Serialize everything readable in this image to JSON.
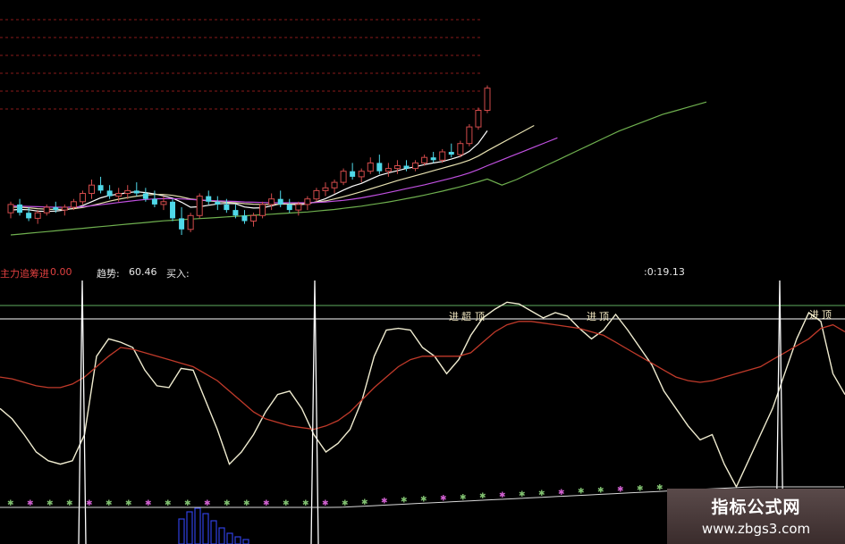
{
  "indicator_bar": {
    "name_label": "主力追筹进",
    "name_value": "0.00",
    "trend_label": "趋势:",
    "trend_value": "60.46",
    "buy_label": "买入:",
    "time_value": ":0:19.13"
  },
  "watermark": {
    "title": "指标公式网",
    "url": "www.zbgs3.com"
  },
  "colors": {
    "background": "#000000",
    "candle_up": "#d24b4b",
    "candle_down": "#4fd8e8",
    "ma_short": "#ffffff",
    "ma_mid": "#e6e0b0",
    "ma_long": "#c050e0",
    "ma_trend": "#6fb04f",
    "osc_fast": "#f0ecd0",
    "osc_slow": "#c03a2a",
    "signal_line": "#ffffff",
    "level_line_green": "#5fae5f",
    "level_line_white": "#ffffff",
    "dashed_grid": "#8a1a1a",
    "pink_marker": "#d060d0",
    "green_marker": "#80c070",
    "volume_bar": "#3040e0"
  },
  "chart_data": [
    {
      "type": "candlestick",
      "title": "",
      "ohlc": [
        [
          48,
          52,
          46,
          51
        ],
        [
          51,
          53,
          47,
          48
        ],
        [
          48,
          50,
          45,
          46
        ],
        [
          46,
          49,
          44,
          48
        ],
        [
          48,
          51,
          47,
          50
        ],
        [
          50,
          52,
          48,
          49
        ],
        [
          49,
          51,
          47,
          50
        ],
        [
          50,
          53,
          49,
          52
        ],
        [
          52,
          56,
          51,
          55
        ],
        [
          55,
          60,
          53,
          58
        ],
        [
          58,
          61,
          55,
          56
        ],
        [
          56,
          58,
          53,
          54
        ],
        [
          54,
          57,
          52,
          55
        ],
        [
          55,
          58,
          53,
          56
        ],
        [
          56,
          59,
          54,
          55
        ],
        [
          55,
          57,
          52,
          53
        ],
        [
          53,
          56,
          50,
          51
        ],
        [
          51,
          54,
          49,
          52
        ],
        [
          52,
          53,
          45,
          46
        ],
        [
          46,
          50,
          40,
          42
        ],
        [
          42,
          48,
          41,
          47
        ],
        [
          47,
          55,
          46,
          54
        ],
        [
          54,
          56,
          51,
          52
        ],
        [
          52,
          54,
          49,
          51
        ],
        [
          51,
          53,
          48,
          49
        ],
        [
          49,
          51,
          46,
          47
        ],
        [
          47,
          49,
          44,
          45
        ],
        [
          45,
          48,
          43,
          47
        ],
        [
          47,
          52,
          46,
          51
        ],
        [
          51,
          55,
          49,
          53
        ],
        [
          53,
          56,
          50,
          51
        ],
        [
          51,
          53,
          48,
          49
        ],
        [
          49,
          52,
          47,
          51
        ],
        [
          51,
          54,
          49,
          53
        ],
        [
          53,
          57,
          52,
          56
        ],
        [
          56,
          59,
          54,
          57
        ],
        [
          57,
          60,
          55,
          59
        ],
        [
          59,
          64,
          58,
          63
        ],
        [
          63,
          66,
          60,
          61
        ],
        [
          61,
          64,
          59,
          63
        ],
        [
          63,
          68,
          62,
          66
        ],
        [
          66,
          69,
          62,
          63
        ],
        [
          63,
          66,
          61,
          64
        ],
        [
          64,
          67,
          62,
          65
        ],
        [
          65,
          67,
          63,
          64
        ],
        [
          64,
          67,
          63,
          66
        ],
        [
          66,
          69,
          65,
          68
        ],
        [
          68,
          70,
          66,
          67
        ],
        [
          67,
          71,
          66,
          70
        ],
        [
          70,
          73,
          68,
          69
        ],
        [
          69,
          74,
          68,
          73
        ],
        [
          73,
          80,
          72,
          79
        ],
        [
          79,
          86,
          78,
          85
        ],
        [
          85,
          94,
          84,
          93
        ]
      ],
      "moving_averages": [
        {
          "values": [
            49,
            49.2,
            49.1,
            48.6,
            48.5,
            48.6,
            49,
            49.6,
            50.6,
            52,
            53.4,
            54.3,
            54.7,
            55.3,
            55.6,
            55.3,
            54.8,
            54.1,
            53.3,
            51.8,
            50,
            50.2,
            50.7,
            51.2,
            51.4,
            51.3,
            50.1,
            49.7,
            49.8,
            50.5,
            51.3,
            51.1,
            50.9,
            51.2,
            52,
            53.1,
            54.6,
            56.2,
            57.6,
            58.6,
            60.1,
            61.5,
            62.4,
            63.2,
            64,
            64.6,
            65.4,
            66,
            66.5,
            67.4,
            68.4,
            70.2,
            73.1,
            77.6
          ]
        },
        {
          "values": [
            50,
            50,
            49.8,
            49.5,
            49.3,
            49.2,
            49.3,
            49.5,
            49.9,
            50.6,
            51.4,
            52.2,
            52.9,
            53.5,
            54,
            54.4,
            54.6,
            54.6,
            54.3,
            53.7,
            53,
            52.6,
            52.3,
            52,
            51.8,
            51.6,
            51.3,
            51.1,
            51,
            51,
            51.1,
            51.2,
            51.3,
            51.5,
            51.8,
            52.3,
            53,
            53.8,
            54.7,
            55.6,
            56.6,
            57.6,
            58.6,
            59.6,
            60.5,
            61.4,
            62.3,
            63.2,
            64.1,
            65,
            65.9,
            67,
            68.5,
            70.4
          ]
        },
        {
          "values": [
            50.5,
            50.4,
            50.3,
            50.2,
            50.1,
            50,
            50,
            50,
            50.2,
            50.5,
            50.9,
            51.3,
            51.7,
            52.1,
            52.5,
            52.8,
            53,
            53.1,
            53.1,
            53,
            52.8,
            52.6,
            52.5,
            52.3,
            52.2,
            52.1,
            51.9,
            51.8,
            51.7,
            51.6,
            51.6,
            51.6,
            51.6,
            51.6,
            51.7,
            51.9,
            52.2,
            52.5,
            52.9,
            53.4,
            54,
            54.6,
            55.3,
            56,
            56.7,
            57.4,
            58.1,
            58.9,
            59.7,
            60.5,
            61.4,
            62.4,
            63.6,
            65
          ]
        },
        {
          "values": [
            40,
            40.3,
            40.6,
            40.9,
            41.2,
            41.5,
            41.8,
            42.1,
            42.4,
            42.7,
            43,
            43.3,
            43.6,
            43.9,
            44.2,
            44.5,
            44.8,
            45.1,
            45.3,
            45.5,
            45.7,
            45.9,
            46.1,
            46.3,
            46.5,
            46.7,
            46.9,
            47.1,
            47.3,
            47.5,
            47.7,
            47.9,
            48.1,
            48.3,
            48.6,
            48.9,
            49.2,
            49.6,
            50,
            50.4,
            50.9,
            51.4,
            51.9,
            52.5,
            53.1,
            53.7,
            54.4,
            55.1,
            55.8,
            56.6,
            57.4,
            58.3,
            59.2,
            60.2
          ]
        }
      ],
      "ma_trend_extension": [
        58,
        60,
        62.5,
        65,
        67.5,
        70,
        72.5,
        75,
        77.5,
        79.5,
        81.5,
        83.5,
        85,
        86.5,
        88
      ]
    },
    {
      "type": "line",
      "title": "",
      "series": [
        {
          "values": [
            40,
            34,
            25,
            15,
            10,
            8,
            10,
            25,
            70,
            80,
            78,
            75,
            62,
            53,
            52,
            63,
            62,
            45,
            28,
            8,
            15,
            25,
            38,
            48,
            50,
            40,
            25,
            15,
            20,
            28,
            45,
            70,
            85,
            86,
            85,
            75,
            70,
            60,
            68,
            82,
            92,
            97,
            101,
            100,
            96,
            92,
            95,
            93,
            86,
            80,
            85,
            94,
            85,
            75,
            65,
            50,
            40,
            30,
            22,
            25,
            8,
            -5,
            10,
            25,
            40,
            60,
            80,
            95,
            90,
            60,
            48
          ]
        },
        {
          "values": [
            58,
            57,
            55,
            53,
            52,
            52,
            54,
            58,
            64,
            70,
            75,
            74,
            72,
            70,
            68,
            66,
            64,
            60,
            56,
            50,
            44,
            38,
            34,
            32,
            30,
            29,
            28,
            30,
            33,
            38,
            45,
            52,
            58,
            64,
            68,
            70,
            70,
            70,
            70,
            72,
            78,
            84,
            88,
            90,
            90,
            89,
            88,
            87,
            86,
            84,
            82,
            78,
            74,
            70,
            66,
            62,
            58,
            56,
            55,
            56,
            58,
            60,
            62,
            64,
            68,
            72,
            76,
            80,
            86,
            88,
            84
          ]
        }
      ],
      "signal_spikes": [
        1,
        3,
        9
      ],
      "labels": [
        {
          "text": "进",
          "index": 39
        },
        {
          "text": "超",
          "index": 42
        },
        {
          "text": "顶",
          "index": 44
        },
        {
          "text": "进",
          "index": 52
        },
        {
          "text": "顶",
          "index": 54
        },
        {
          "text": "进",
          "index": 72
        },
        {
          "text": "顶",
          "index": 74
        }
      ],
      "ylim": [
        -10,
        110
      ],
      "grid": false
    }
  ]
}
